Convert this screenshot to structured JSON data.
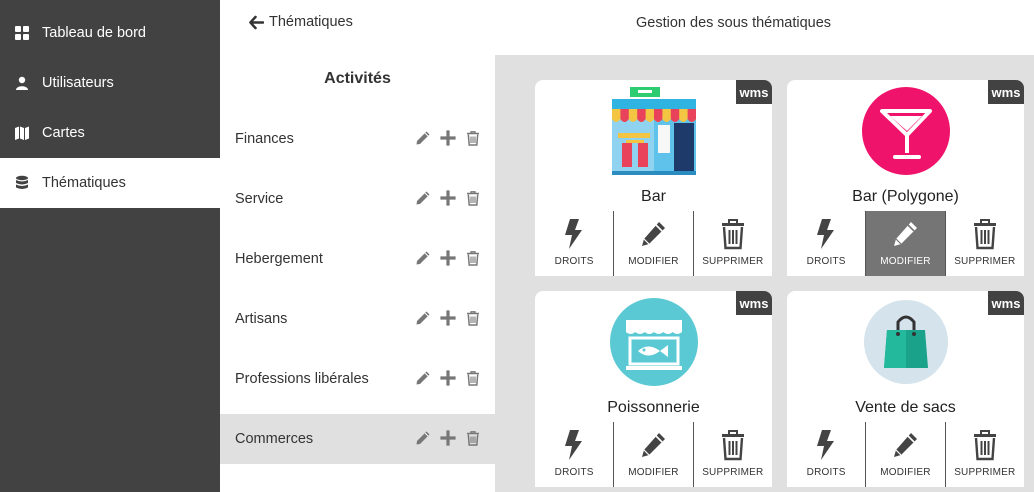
{
  "sidebar": {
    "items": [
      {
        "label": "Tableau de bord",
        "icon": "dashboard-icon"
      },
      {
        "label": "Utilisateurs",
        "icon": "user-icon"
      },
      {
        "label": "Cartes",
        "icon": "map-icon"
      },
      {
        "label": "Thématiques",
        "icon": "database-icon",
        "active": true
      }
    ]
  },
  "header": {
    "back_label": "Thématiques",
    "title": "Gestion des sous thématiques"
  },
  "list": {
    "title": "Activités",
    "rows": [
      {
        "label": "Finances"
      },
      {
        "label": "Service"
      },
      {
        "label": "Hebergement"
      },
      {
        "label": "Artisans"
      },
      {
        "label": "Professions libérales"
      },
      {
        "label": "Commerces",
        "selected": true
      }
    ]
  },
  "cards": [
    {
      "name": "Bar",
      "badge": "wms",
      "image": "shop-front-icon",
      "highlight": ""
    },
    {
      "name": "Bar (Polygone)",
      "badge": "wms",
      "image": "cocktail-icon",
      "highlight": "modifier"
    },
    {
      "name": "Poissonnerie",
      "badge": "wms",
      "image": "fish-shop-icon",
      "highlight": ""
    },
    {
      "name": "Vente de sacs",
      "badge": "wms",
      "image": "shopping-bag-icon",
      "highlight": ""
    }
  ],
  "card_actions": {
    "rights": "DROITS",
    "edit": "MODIFIER",
    "delete": "SUPPRIMER"
  },
  "colors": {
    "sidebar_bg": "#424242",
    "content_bg": "#e0e0e0",
    "selected_row": "#e0e0e0",
    "cocktail_pink": "#f0136b",
    "fish_teal": "#5bc9d4",
    "bag_green": "#1aa38a"
  }
}
